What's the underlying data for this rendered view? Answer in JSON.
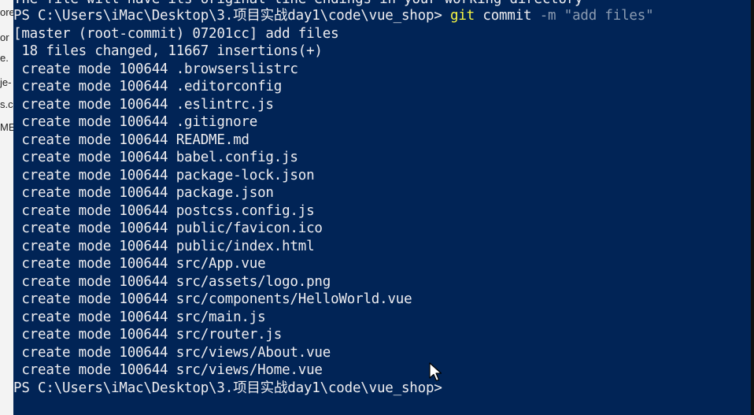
{
  "top_clipped_text": "The file will have its original line endings in your working directory",
  "prompt": "PS C:\\Users\\iMac\\Desktop\\3.项目实战day1\\code\\vue_shop>",
  "command": {
    "git": "git",
    "commit": "commit",
    "flag": "-m",
    "message": "\"add files\""
  },
  "commit_summary": "[master (root-commit) 07201cc] add files",
  "stats": " 18 files changed, 11667 insertions(+)",
  "created_files": [
    " create mode 100644 .browserslistrc",
    " create mode 100644 .editorconfig",
    " create mode 100644 .eslintrc.js",
    " create mode 100644 .gitignore",
    " create mode 100644 README.md",
    " create mode 100644 babel.config.js",
    " create mode 100644 package-lock.json",
    " create mode 100644 package.json",
    " create mode 100644 postcss.config.js",
    " create mode 100644 public/favicon.ico",
    " create mode 100644 public/index.html",
    " create mode 100644 src/App.vue",
    " create mode 100644 src/assets/logo.png",
    " create mode 100644 src/components/HelloWorld.vue",
    " create mode 100644 src/main.js",
    " create mode 100644 src/router.js",
    " create mode 100644 src/views/About.vue",
    " create mode 100644 src/views/Home.vue"
  ],
  "final_prompt": "PS C:\\Users\\iMac\\Desktop\\3.项目实战day1\\code\\vue_shop>",
  "left_strip_fragments": [
    "ore",
    "or",
    "e.",
    "je-",
    "s.c",
    "ME."
  ],
  "colors": {
    "background": "#012456",
    "foreground": "#eeedf0",
    "command_yellow": "#f5f543",
    "string_gray": "#8b9bb1"
  }
}
